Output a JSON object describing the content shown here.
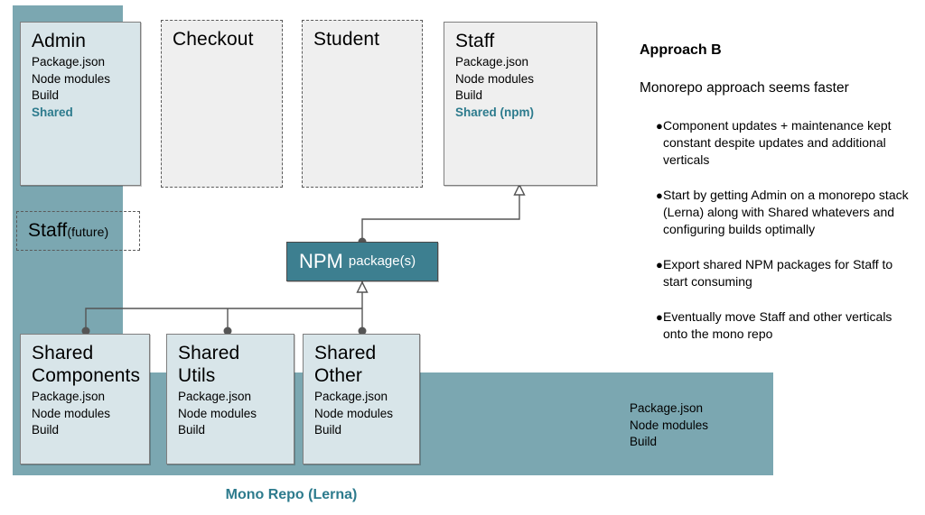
{
  "diagram": {
    "mono_repo_label": "Mono Repo (Lerna)",
    "band_lines": {
      "l1": "Package.json",
      "l2": "Node modules",
      "l3": "Build"
    },
    "boxes": {
      "admin": {
        "title": "Admin",
        "lines": [
          "Package.json",
          "Node modules",
          "Build"
        ],
        "accent_line": "Shared"
      },
      "checkout": {
        "title": "Checkout"
      },
      "student": {
        "title": "Student"
      },
      "staff": {
        "title": "Staff",
        "lines": [
          "Package.json",
          "Node modules",
          "Build"
        ],
        "accent_line": "Shared (npm)"
      },
      "staff_future": {
        "title": "Staff",
        "suffix": "(future)"
      },
      "npm": {
        "title": "NPM",
        "suffix": "package(s)"
      },
      "shared_components": {
        "title_l1": "Shared",
        "title_l2": "Components",
        "lines": [
          "Package.json",
          "Node modules",
          "Build"
        ]
      },
      "shared_utils": {
        "title_l1": "Shared",
        "title_l2": "Utils",
        "lines": [
          "Package.json",
          "Node modules",
          "Build"
        ]
      },
      "shared_other": {
        "title_l1": "Shared",
        "title_l2": "Other",
        "lines": [
          "Package.json",
          "Node modules",
          "Build"
        ]
      }
    }
  },
  "approach": {
    "title": "Approach B",
    "subtitle": "Monorepo approach seems faster",
    "bullet_marker": "●",
    "bullets": [
      "Component updates + maintenance kept constant despite updates and additional verticals",
      "Start by getting Admin on a monorepo stack (Lerna) along with Shared whatevers and configuring builds optimally",
      "Export shared NPM packages for Staff to start consuming",
      "Eventually move Staff and other verticals onto the mono repo"
    ]
  },
  "colors": {
    "band_teal": "#7ba7b1",
    "npm_teal": "#3d7f90",
    "accent_text": "#2d7b8d",
    "box_light": "#d8e5e9",
    "box_gray": "#efefef"
  }
}
